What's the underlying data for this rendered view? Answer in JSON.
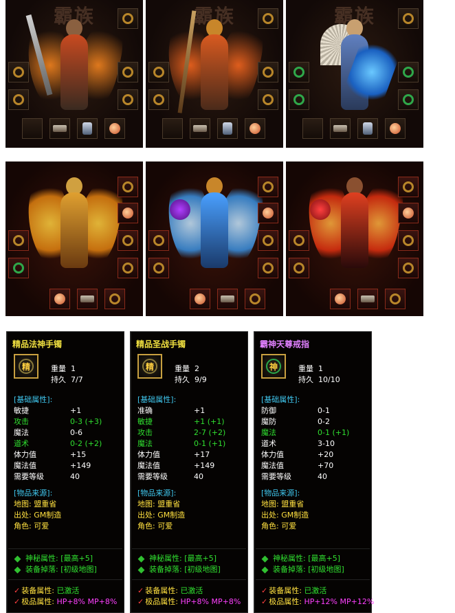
{
  "panels_top": [
    {
      "logo": "霸族",
      "figure": "warrior-with-sword"
    },
    {
      "logo": "霸族",
      "figure": "mage-with-staff"
    },
    {
      "logo": "霸族",
      "figure": "taoist-with-fan"
    }
  ],
  "panels_mid": [
    {
      "figure": "golden-winged-warrior"
    },
    {
      "figure": "blue-winged-mage"
    },
    {
      "figure": "red-winged-taoist"
    }
  ],
  "tooltips": [
    {
      "name": "精品法神手镯",
      "icon_char": "精",
      "weight_label": "重量",
      "weight": "1",
      "durability_label": "持久",
      "durability": "7/7",
      "base_header": "[基础属性]:",
      "stats": [
        {
          "label": "敏捷",
          "value": "+1",
          "color": "white"
        },
        {
          "label": "攻击",
          "value": "0-3 (+3)",
          "color": "green"
        },
        {
          "label": "魔法",
          "value": "0-6",
          "color": "white"
        },
        {
          "label": "道术",
          "value": "0-2 (+2)",
          "color": "green"
        },
        {
          "label": "体力值",
          "value": "+15",
          "color": "white"
        },
        {
          "label": "魔法值",
          "value": "+149",
          "color": "white"
        },
        {
          "label": "需要等级",
          "value": "40",
          "color": "white"
        }
      ],
      "source_header": "[物品来源]:",
      "sources": [
        "地图: 盟重省",
        "出处: GM制造",
        "角色: 可爱"
      ],
      "mystic": "神秘属性: [最高+5]",
      "drop": "装备掉落: [初级地图]",
      "equip_attr_label": "装备属性:",
      "equip_attr_value": "已激活",
      "premium_label": "极品属性:",
      "premium_value": "HP+8% MP+8%"
    },
    {
      "name": "精品圣战手镯",
      "icon_char": "精",
      "weight_label": "重量",
      "weight": "2",
      "durability_label": "持久",
      "durability": "9/9",
      "base_header": "[基础属性]:",
      "stats": [
        {
          "label": "准确",
          "value": "+1",
          "color": "white"
        },
        {
          "label": "敏捷",
          "value": "+1 (+1)",
          "color": "green"
        },
        {
          "label": "攻击",
          "value": "2-7 (+2)",
          "color": "green"
        },
        {
          "label": "魔法",
          "value": "0-1 (+1)",
          "color": "green"
        },
        {
          "label": "体力值",
          "value": "+17",
          "color": "white"
        },
        {
          "label": "魔法值",
          "value": "+149",
          "color": "white"
        },
        {
          "label": "需要等级",
          "value": "40",
          "color": "white"
        }
      ],
      "source_header": "[物品来源]:",
      "sources": [
        "地图: 盟重省",
        "出处: GM制造",
        "角色: 可爱"
      ],
      "mystic": "神秘属性: [最高+5]",
      "drop": "装备掉落: [初级地图]",
      "equip_attr_label": "装备属性:",
      "equip_attr_value": "已激活",
      "premium_label": "极品属性:",
      "premium_value": "HP+8% MP+8%"
    },
    {
      "name": "霸神天尊戒指",
      "icon_char": "神",
      "weight_label": "重量",
      "weight": "1",
      "durability_label": "持久",
      "durability": "10/10",
      "base_header": "[基础属性]:",
      "stats": [
        {
          "label": "防御",
          "value": "0-1",
          "color": "white"
        },
        {
          "label": "魔防",
          "value": "0-2",
          "color": "white"
        },
        {
          "label": "魔法",
          "value": "0-1 (+1)",
          "color": "green"
        },
        {
          "label": "道术",
          "value": "3-10",
          "color": "white"
        },
        {
          "label": "体力值",
          "value": "+20",
          "color": "white"
        },
        {
          "label": "魔法值",
          "value": "+70",
          "color": "white"
        },
        {
          "label": "需要等级",
          "value": "40",
          "color": "white"
        }
      ],
      "source_header": "[物品来源]:",
      "sources": [
        "地图: 盟重省",
        "出处: GM制造",
        "角色: 可爱"
      ],
      "mystic": "神秘属性: [最高+5]",
      "drop": "装备掉落: [初级地图]",
      "equip_attr_label": "装备属性:",
      "equip_attr_value": "已激活",
      "premium_label": "极品属性:",
      "premium_value": "HP+12% MP+12%"
    }
  ]
}
